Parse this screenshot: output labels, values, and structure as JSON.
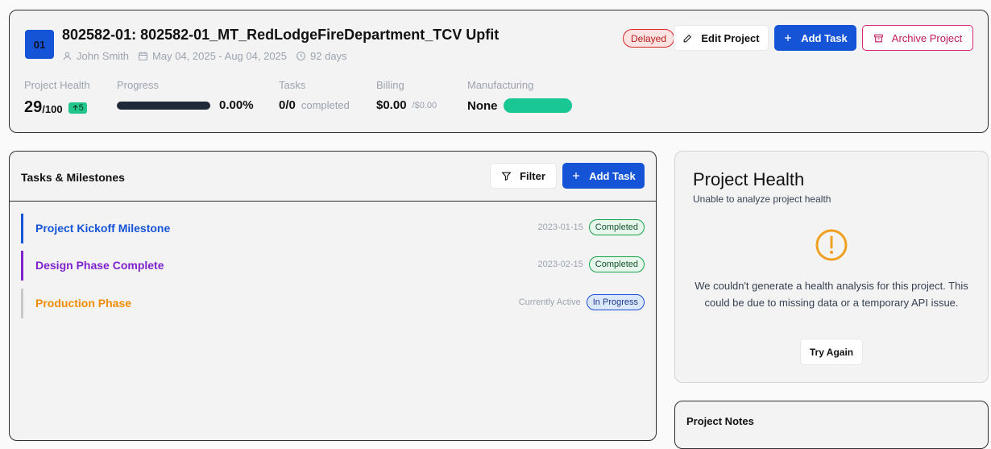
{
  "project": {
    "badge": "01",
    "title": "802582-01: 802582-01_MT_RedLodgeFireDepartment_TCV Upfit",
    "owner": "John Smith",
    "date_range": "May 04, 2025 - Aug 04, 2025",
    "duration": "92 days",
    "status": "Delayed"
  },
  "actions": {
    "edit": "Edit Project",
    "add_task": "Add Task",
    "archive": "Archive Project"
  },
  "stats": {
    "health_label": "Project Health",
    "health_value": "29",
    "health_max": "/100",
    "health_delta": "5",
    "progress_label": "Progress",
    "progress_value": "0.00%",
    "progress_fraction": 0,
    "tasks_label": "Tasks",
    "tasks_value": "0/0",
    "tasks_suffix": "completed",
    "billing_label": "Billing",
    "billing_value": "$0.00",
    "billing_total": "/$0.00",
    "manufacturing_label": "Manufacturing",
    "manufacturing_value": "None"
  },
  "tasks_panel": {
    "title": "Tasks & Milestones",
    "filter": "Filter",
    "add_task": "Add Task",
    "milestones": [
      {
        "title": "Project Kickoff Milestone",
        "date": "2023-01-15",
        "status": "Completed",
        "color": "#1554d6"
      },
      {
        "title": "Design Phase Complete",
        "date": "2023-02-15",
        "status": "Completed",
        "color": "#7e22ce"
      },
      {
        "title": "Production Phase",
        "date": "Currently Active",
        "status": "In Progress",
        "color": "#f08c00"
      }
    ]
  },
  "health_panel": {
    "title": "Project Health",
    "subtitle": "Unable to analyze project health",
    "message": "We couldn't generate a health analysis for this project. This could be due to missing data or a temporary API issue.",
    "retry": "Try Again",
    "icon": "warning-icon",
    "icon_color": "#f0a020"
  },
  "notes_panel": {
    "title": "Project Notes"
  },
  "colors": {
    "accent": "#1554d6",
    "danger": "#dc2626",
    "success": "#16a34a",
    "manufacturing": "#18c794"
  }
}
